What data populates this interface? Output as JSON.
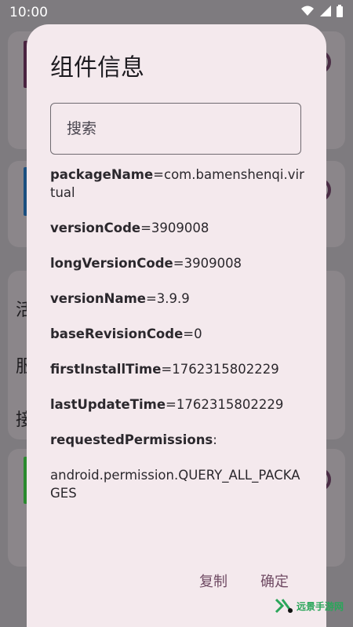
{
  "status_bar": {
    "time": "10:00"
  },
  "background": {
    "items": [
      "活",
      "服",
      "接"
    ]
  },
  "dialog": {
    "title": "组件信息",
    "search_placeholder": "搜索",
    "fields": [
      {
        "key": "packageName",
        "value": "=com.bamenshenqi.virtual"
      },
      {
        "key": "versionCode",
        "value": "=3909008"
      },
      {
        "key": "longVersionCode",
        "value": "=3909008"
      },
      {
        "key": "versionName",
        "value": "=3.9.9"
      },
      {
        "key": "baseRevisionCode",
        "value": "=0"
      },
      {
        "key": "firstInstallTime",
        "value": "=1762315802229"
      },
      {
        "key": "lastUpdateTime",
        "value": "=1762315802229"
      },
      {
        "key": "requestedPermissions",
        "value": ":"
      }
    ],
    "permission": "android.permission.QUERY_ALL_PACKAGES",
    "copy_label": "复制",
    "confirm_label": "确定"
  },
  "watermark": {
    "text": "远景手游网"
  },
  "colors": {
    "dialog_bg": "#f4e9ed",
    "accent": "#6f4a63"
  }
}
